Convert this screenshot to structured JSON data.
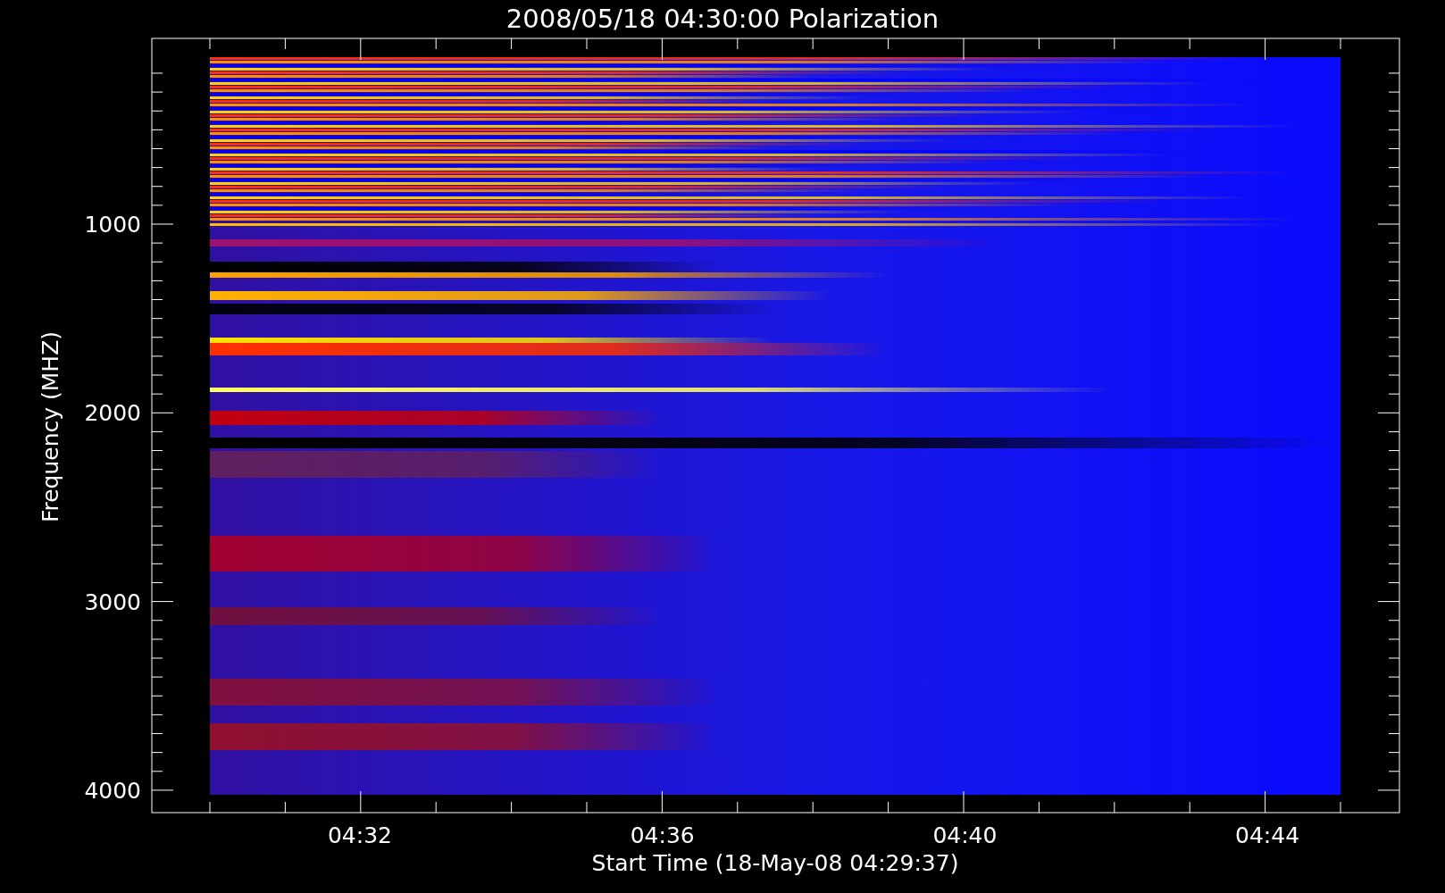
{
  "title": "2008/05/18 04:30:00 Polarization",
  "y_axis": {
    "label": "Frequency (MHZ)",
    "ticks": [
      "1000",
      "2000",
      "3000",
      "4000"
    ]
  },
  "x_axis": {
    "label": "Start Time (18-May-08 04:29:37)",
    "ticks": [
      "04:32",
      "04:36",
      "04:40",
      "04:44"
    ]
  }
}
